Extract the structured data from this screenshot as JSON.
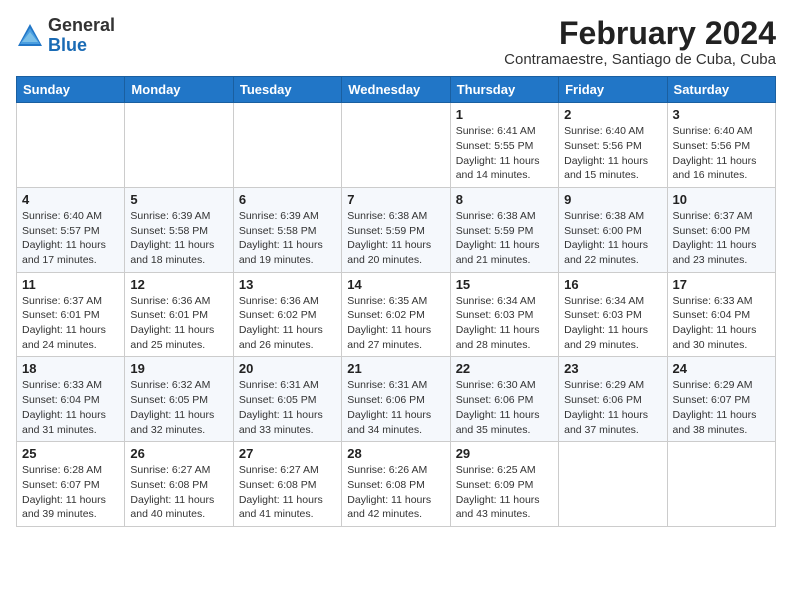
{
  "logo": {
    "general": "General",
    "blue": "Blue"
  },
  "title": "February 2024",
  "subtitle": "Contramaestre, Santiago de Cuba, Cuba",
  "days_of_week": [
    "Sunday",
    "Monday",
    "Tuesday",
    "Wednesday",
    "Thursday",
    "Friday",
    "Saturday"
  ],
  "weeks": [
    [
      {
        "day": "",
        "info": ""
      },
      {
        "day": "",
        "info": ""
      },
      {
        "day": "",
        "info": ""
      },
      {
        "day": "",
        "info": ""
      },
      {
        "day": "1",
        "info": "Sunrise: 6:41 AM\nSunset: 5:55 PM\nDaylight: 11 hours and 14 minutes."
      },
      {
        "day": "2",
        "info": "Sunrise: 6:40 AM\nSunset: 5:56 PM\nDaylight: 11 hours and 15 minutes."
      },
      {
        "day": "3",
        "info": "Sunrise: 6:40 AM\nSunset: 5:56 PM\nDaylight: 11 hours and 16 minutes."
      }
    ],
    [
      {
        "day": "4",
        "info": "Sunrise: 6:40 AM\nSunset: 5:57 PM\nDaylight: 11 hours and 17 minutes."
      },
      {
        "day": "5",
        "info": "Sunrise: 6:39 AM\nSunset: 5:58 PM\nDaylight: 11 hours and 18 minutes."
      },
      {
        "day": "6",
        "info": "Sunrise: 6:39 AM\nSunset: 5:58 PM\nDaylight: 11 hours and 19 minutes."
      },
      {
        "day": "7",
        "info": "Sunrise: 6:38 AM\nSunset: 5:59 PM\nDaylight: 11 hours and 20 minutes."
      },
      {
        "day": "8",
        "info": "Sunrise: 6:38 AM\nSunset: 5:59 PM\nDaylight: 11 hours and 21 minutes."
      },
      {
        "day": "9",
        "info": "Sunrise: 6:38 AM\nSunset: 6:00 PM\nDaylight: 11 hours and 22 minutes."
      },
      {
        "day": "10",
        "info": "Sunrise: 6:37 AM\nSunset: 6:00 PM\nDaylight: 11 hours and 23 minutes."
      }
    ],
    [
      {
        "day": "11",
        "info": "Sunrise: 6:37 AM\nSunset: 6:01 PM\nDaylight: 11 hours and 24 minutes."
      },
      {
        "day": "12",
        "info": "Sunrise: 6:36 AM\nSunset: 6:01 PM\nDaylight: 11 hours and 25 minutes."
      },
      {
        "day": "13",
        "info": "Sunrise: 6:36 AM\nSunset: 6:02 PM\nDaylight: 11 hours and 26 minutes."
      },
      {
        "day": "14",
        "info": "Sunrise: 6:35 AM\nSunset: 6:02 PM\nDaylight: 11 hours and 27 minutes."
      },
      {
        "day": "15",
        "info": "Sunrise: 6:34 AM\nSunset: 6:03 PM\nDaylight: 11 hours and 28 minutes."
      },
      {
        "day": "16",
        "info": "Sunrise: 6:34 AM\nSunset: 6:03 PM\nDaylight: 11 hours and 29 minutes."
      },
      {
        "day": "17",
        "info": "Sunrise: 6:33 AM\nSunset: 6:04 PM\nDaylight: 11 hours and 30 minutes."
      }
    ],
    [
      {
        "day": "18",
        "info": "Sunrise: 6:33 AM\nSunset: 6:04 PM\nDaylight: 11 hours and 31 minutes."
      },
      {
        "day": "19",
        "info": "Sunrise: 6:32 AM\nSunset: 6:05 PM\nDaylight: 11 hours and 32 minutes."
      },
      {
        "day": "20",
        "info": "Sunrise: 6:31 AM\nSunset: 6:05 PM\nDaylight: 11 hours and 33 minutes."
      },
      {
        "day": "21",
        "info": "Sunrise: 6:31 AM\nSunset: 6:06 PM\nDaylight: 11 hours and 34 minutes."
      },
      {
        "day": "22",
        "info": "Sunrise: 6:30 AM\nSunset: 6:06 PM\nDaylight: 11 hours and 35 minutes."
      },
      {
        "day": "23",
        "info": "Sunrise: 6:29 AM\nSunset: 6:06 PM\nDaylight: 11 hours and 37 minutes."
      },
      {
        "day": "24",
        "info": "Sunrise: 6:29 AM\nSunset: 6:07 PM\nDaylight: 11 hours and 38 minutes."
      }
    ],
    [
      {
        "day": "25",
        "info": "Sunrise: 6:28 AM\nSunset: 6:07 PM\nDaylight: 11 hours and 39 minutes."
      },
      {
        "day": "26",
        "info": "Sunrise: 6:27 AM\nSunset: 6:08 PM\nDaylight: 11 hours and 40 minutes."
      },
      {
        "day": "27",
        "info": "Sunrise: 6:27 AM\nSunset: 6:08 PM\nDaylight: 11 hours and 41 minutes."
      },
      {
        "day": "28",
        "info": "Sunrise: 6:26 AM\nSunset: 6:08 PM\nDaylight: 11 hours and 42 minutes."
      },
      {
        "day": "29",
        "info": "Sunrise: 6:25 AM\nSunset: 6:09 PM\nDaylight: 11 hours and 43 minutes."
      },
      {
        "day": "",
        "info": ""
      },
      {
        "day": "",
        "info": ""
      }
    ]
  ]
}
